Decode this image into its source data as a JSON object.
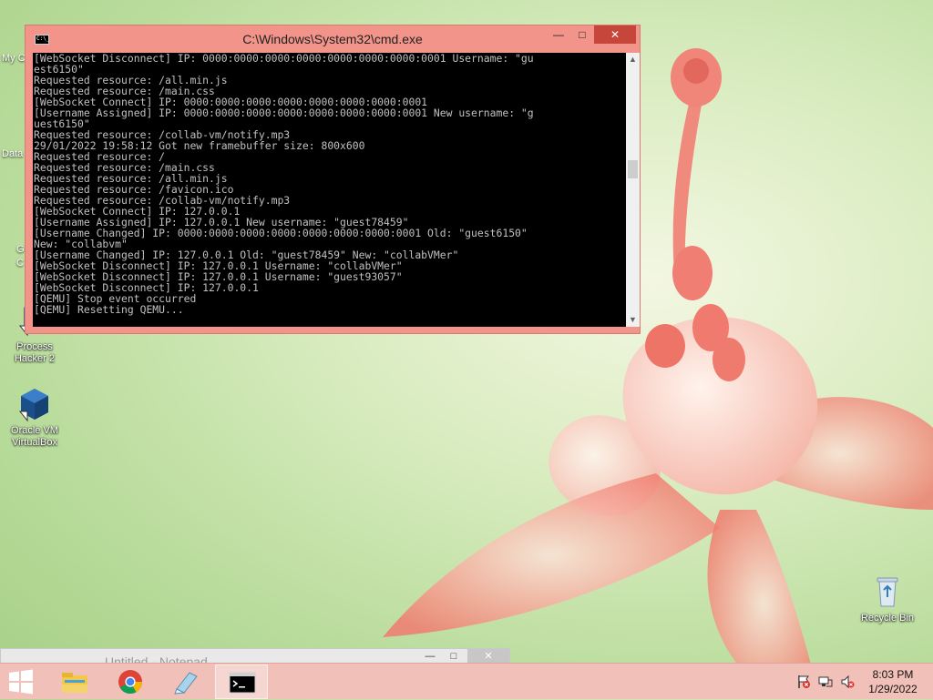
{
  "desktop": {
    "icons": [
      {
        "label": "Process Hacker 2"
      },
      {
        "label": "Oracle VM VirtualBox"
      },
      {
        "label": "Recycle Bin"
      }
    ],
    "partial_labels": [
      "My C",
      "Data",
      "G",
      "C"
    ]
  },
  "notepad": {
    "title": "Untitled - Notepad",
    "min": "—",
    "max": "□",
    "close": "✕"
  },
  "cmd": {
    "title": "C:\\Windows\\System32\\cmd.exe",
    "icon_text": "C:\\_",
    "min": "—",
    "max": "□",
    "close": "✕",
    "lines": [
      "[WebSocket Disconnect] IP: 0000:0000:0000:0000:0000:0000:0000:0001 Username: \"gu",
      "est6150\"",
      "Requested resource: /all.min.js",
      "Requested resource: /main.css",
      "[WebSocket Connect] IP: 0000:0000:0000:0000:0000:0000:0000:0001",
      "[Username Assigned] IP: 0000:0000:0000:0000:0000:0000:0000:0001 New username: \"g",
      "uest6150\"",
      "Requested resource: /collab-vm/notify.mp3",
      "29/01/2022 19:58:12 Got new framebuffer size: 800x600",
      "Requested resource: /",
      "Requested resource: /main.css",
      "Requested resource: /all.min.js",
      "Requested resource: /favicon.ico",
      "Requested resource: /collab-vm/notify.mp3",
      "[WebSocket Connect] IP: 127.0.0.1",
      "[Username Assigned] IP: 127.0.0.1 New username: \"guest78459\"",
      "[Username Changed] IP: 0000:0000:0000:0000:0000:0000:0000:0001 Old: \"guest6150\"",
      "New: \"collabvm\"",
      "[Username Changed] IP: 127.0.0.1 Old: \"guest78459\" New: \"collabVMer\"",
      "[WebSocket Disconnect] IP: 127.0.0.1 Username: \"collabVMer\"",
      "[WebSocket Disconnect] IP: 127.0.0.1 Username: \"guest93057\"",
      "[WebSocket Disconnect] IP: 127.0.0.1",
      "[QEMU] Stop event occurred",
      "[QEMU] Resetting QEMU..."
    ]
  },
  "taskbar": {
    "apps": [
      {
        "icon": "file-explorer-icon"
      },
      {
        "icon": "chrome-icon"
      },
      {
        "icon": "notepad-icon"
      },
      {
        "icon": "cmd-icon"
      }
    ],
    "clock": {
      "time": "8:03 PM",
      "date": "1/29/2022"
    }
  },
  "colors": {
    "accent": "#f2948a",
    "taskbar": "#f1c0b8",
    "close_button": "#c7463b"
  }
}
